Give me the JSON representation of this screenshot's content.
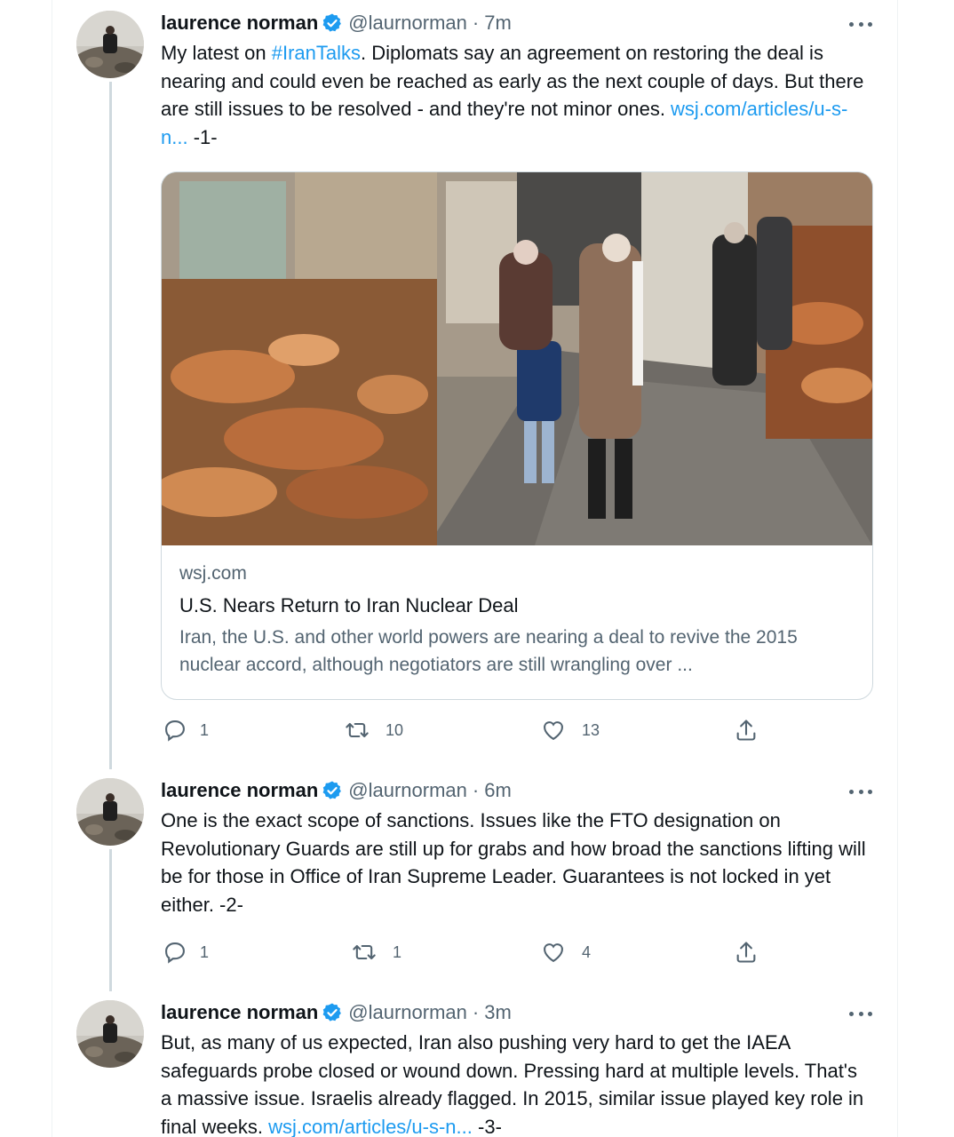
{
  "tweets": [
    {
      "name": "laurence norman",
      "handle": "@laurnorman",
      "separator": "·",
      "time": "7m",
      "text_parts": {
        "p1": "My latest on ",
        "hashtag": "#IranTalks",
        "p2": ". Diplomats say an agreement on restoring the deal is nearing and could even be reached as early as the next couple of days. But there are still issues to be resolved - and they're not minor ones. ",
        "link": "wsj.com/articles/u-s-n...",
        "p3": " -1-"
      },
      "card": {
        "domain": "wsj.com",
        "title": "U.S. Nears Return to Iran Nuclear Deal",
        "description": "Iran, the U.S. and other world powers are nearing a deal to revive the 2015 nuclear accord, although negotiators are still wrangling over ..."
      },
      "replies": "1",
      "retweets": "10",
      "likes": "13"
    },
    {
      "name": "laurence norman",
      "handle": "@laurnorman",
      "separator": "·",
      "time": "6m",
      "text": "One is the exact scope of sanctions. Issues like the FTO designation on Revolutionary Guards are still up for grabs and how broad the sanctions lifting will be for those in Office of Iran Supreme Leader. Guarantees is not locked in yet either.  -2-",
      "replies": "1",
      "retweets": "1",
      "likes": "4"
    },
    {
      "name": "laurence norman",
      "handle": "@laurnorman",
      "separator": "·",
      "time": "3m",
      "text_parts": {
        "p1": "But, as many of us expected, Iran also pushing very hard to get the IAEA safeguards probe closed or wound down. Pressing hard at multiple levels. That's a massive issue. Israelis already flagged. In 2015, similar issue played key role in final weeks. ",
        "link": "wsj.com/articles/u-s-n...",
        "p2": " -3-"
      }
    }
  ],
  "icons": [
    "verified-badge-icon",
    "more-icon",
    "reply-icon",
    "retweet-icon",
    "like-icon",
    "share-icon"
  ],
  "colors": {
    "accent": "#1d9bf0",
    "text": "#0f1419",
    "muted": "#536471",
    "border": "#cfd9de"
  }
}
